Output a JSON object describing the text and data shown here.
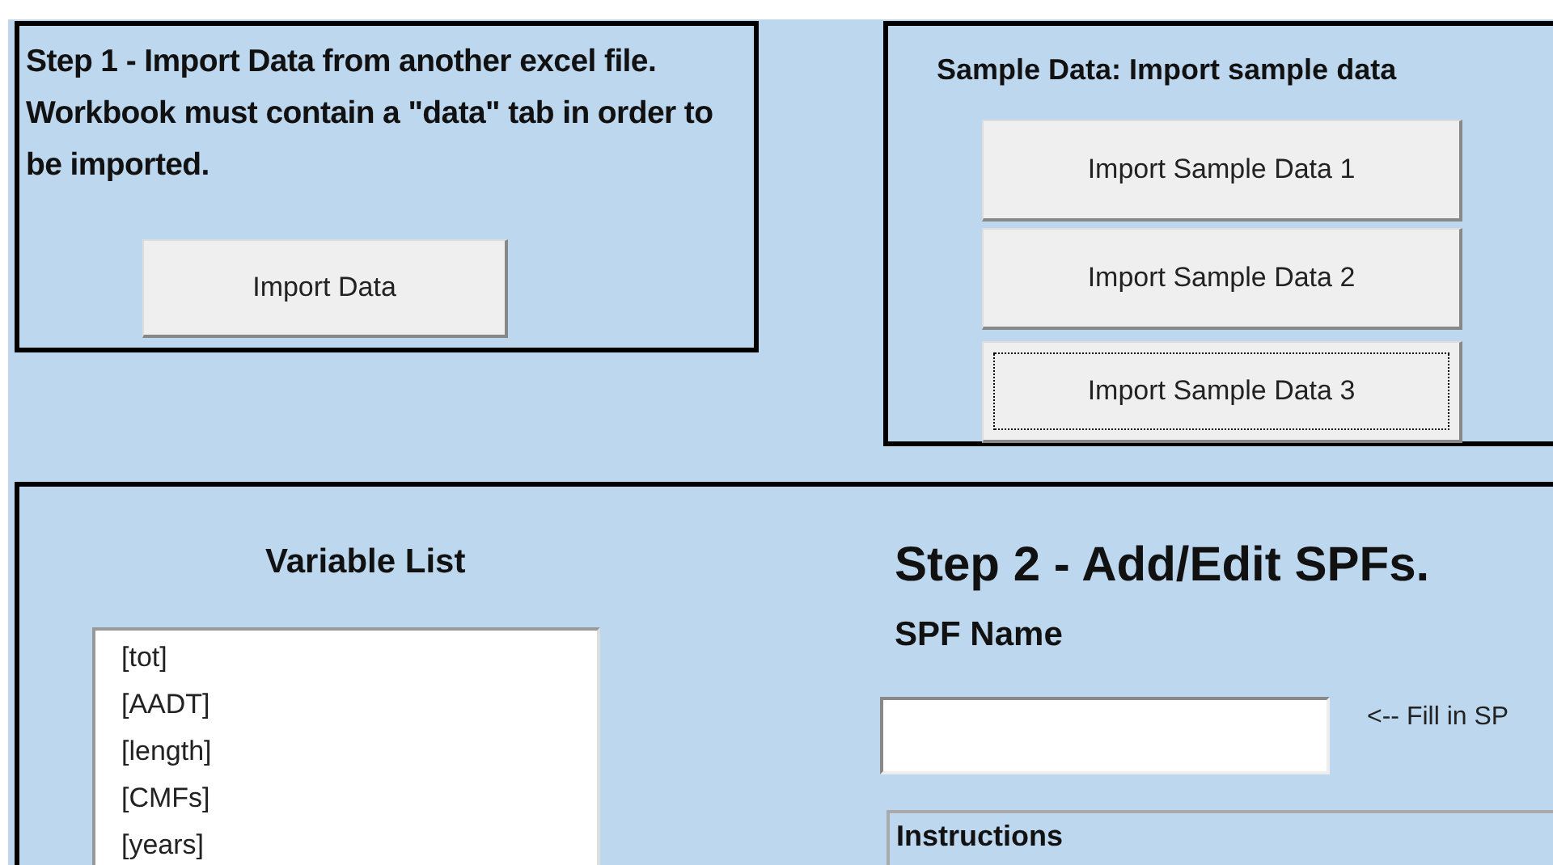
{
  "step1": {
    "text": "Step 1 - Import Data from another excel file.  Workbook must contain a \"data\" tab in order to be imported.",
    "button": "Import Data"
  },
  "sample": {
    "title": "Sample Data: Import sample data",
    "buttons": [
      {
        "label": "Import Sample Data 1",
        "focused": false
      },
      {
        "label": "Import Sample Data 2",
        "focused": false
      },
      {
        "label": "Import Sample Data 3",
        "focused": true
      }
    ]
  },
  "variables": {
    "title": "Variable List",
    "items": [
      "[tot]",
      "[AADT]",
      "[length]",
      "[CMFs]",
      "[years]"
    ]
  },
  "step2": {
    "title": "Step 2 - Add/Edit SPFs.",
    "name_label": "SPF Name",
    "hint": "<-- Fill in SP",
    "instructions_title": "Instructions"
  }
}
